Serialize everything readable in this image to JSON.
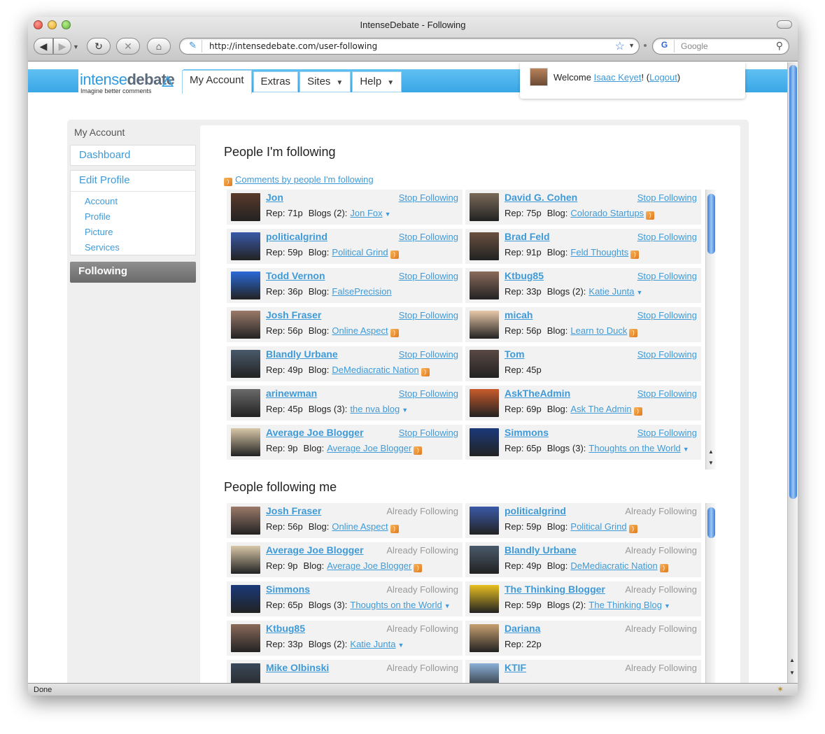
{
  "window": {
    "title": "IntenseDebate - Following"
  },
  "toolbar": {
    "url": "http://intensedebate.com/user-following",
    "search_placeholder": "Google",
    "back_icon": "back-arrow-icon",
    "forward_icon": "forward-arrow-icon",
    "reload_icon": "reload-icon",
    "stop_icon": "stop-icon",
    "home_icon": "home-icon"
  },
  "status": {
    "text": "Done"
  },
  "site": {
    "logo_light": "intense",
    "logo_bold": "debate",
    "tagline": "Imagine better comments",
    "tabs": [
      "My Account",
      "Extras",
      "Sites",
      "Help"
    ],
    "welcome_prefix": "Welcome",
    "user_name": "Isaac Keyet",
    "logout": "Logout"
  },
  "sidebar": {
    "heading": "My Account",
    "dashboard": "Dashboard",
    "edit_profile": "Edit Profile",
    "sub_items": [
      "Account",
      "Profile",
      "Picture",
      "Services"
    ],
    "following": "Following"
  },
  "following": {
    "title": "People I'm following",
    "rss_link": "Comments by people I'm following",
    "action": "Stop Following",
    "items": [
      {
        "name": "Jon",
        "rep": "Rep: 71p",
        "blogs_label": "Blogs (2):",
        "blog": "Jon Fox",
        "kind": "dropdown",
        "avatar": "#5a3a2a"
      },
      {
        "name": "David G. Cohen",
        "rep": "Rep: 75p",
        "blogs_label": "Blog:",
        "blog": "Colorado Startups",
        "kind": "rss",
        "avatar": "#7a6a5a"
      },
      {
        "name": "politicalgrind",
        "rep": "Rep: 59p",
        "blogs_label": "Blog:",
        "blog": "Political Grind",
        "kind": "rss",
        "avatar": "#3a5aa8"
      },
      {
        "name": "Brad Feld",
        "rep": "Rep: 91p",
        "blogs_label": "Blog:",
        "blog": "Feld Thoughts",
        "kind": "rss",
        "avatar": "#6a5040"
      },
      {
        "name": "Todd Vernon",
        "rep": "Rep: 36p",
        "blogs_label": "Blog:",
        "blog": "FalsePrecision",
        "kind": "none",
        "avatar": "#2a6ad8"
      },
      {
        "name": "Ktbug85",
        "rep": "Rep: 33p",
        "blogs_label": "Blogs (2):",
        "blog": "Katie Junta",
        "kind": "dropdown",
        "avatar": "#8a6a5a"
      },
      {
        "name": "Josh Fraser",
        "rep": "Rep: 56p",
        "blogs_label": "Blog:",
        "blog": "Online Aspect",
        "kind": "rss",
        "avatar": "#9a7a6a"
      },
      {
        "name": "micah",
        "rep": "Rep: 56p",
        "blogs_label": "Blog:",
        "blog": "Learn to Duck",
        "kind": "rss",
        "avatar": "#e8c8a8"
      },
      {
        "name": "Blandly Urbane",
        "rep": "Rep: 49p",
        "blogs_label": "Blog:",
        "blog": "DeMediacratic Nation",
        "kind": "rss",
        "avatar": "#4a5a6a"
      },
      {
        "name": "Tom",
        "rep": "Rep: 45p",
        "blogs_label": "",
        "blog": "",
        "kind": "none",
        "avatar": "#5a4a44"
      },
      {
        "name": "arinewman",
        "rep": "Rep: 45p",
        "blogs_label": "Blogs (3):",
        "blog": "the nva blog",
        "kind": "dropdown",
        "avatar": "#6a6a6a"
      },
      {
        "name": "AskTheAdmin",
        "rep": "Rep: 69p",
        "blogs_label": "Blog:",
        "blog": "Ask The Admin",
        "kind": "rss",
        "avatar": "#c85a2a"
      },
      {
        "name": "Average Joe Blogger",
        "rep": "Rep: 9p",
        "blogs_label": "Blog:",
        "blog": "Average Joe Blogger",
        "kind": "rss",
        "avatar": "#d8c8a8"
      },
      {
        "name": "Simmons",
        "rep": "Rep: 65p",
        "blogs_label": "Blogs (3):",
        "blog": "Thoughts on the World",
        "kind": "dropdown",
        "avatar": "#1a3a7a"
      }
    ]
  },
  "followers": {
    "title": "People following me",
    "action": "Already Following",
    "items": [
      {
        "name": "Josh Fraser",
        "rep": "Rep: 56p",
        "blogs_label": "Blog:",
        "blog": "Online Aspect",
        "kind": "rss",
        "avatar": "#9a7a6a"
      },
      {
        "name": "politicalgrind",
        "rep": "Rep: 59p",
        "blogs_label": "Blog:",
        "blog": "Political Grind",
        "kind": "rss",
        "avatar": "#3a5aa8"
      },
      {
        "name": "Average Joe Blogger",
        "rep": "Rep: 9p",
        "blogs_label": "Blog:",
        "blog": "Average Joe Blogger",
        "kind": "rss",
        "avatar": "#d8c8a8"
      },
      {
        "name": "Blandly Urbane",
        "rep": "Rep: 49p",
        "blogs_label": "Blog:",
        "blog": "DeMediacratic Nation",
        "kind": "rss",
        "avatar": "#4a5a6a"
      },
      {
        "name": "Simmons",
        "rep": "Rep: 65p",
        "blogs_label": "Blogs (3):",
        "blog": "Thoughts on the World",
        "kind": "dropdown",
        "avatar": "#1a3a7a"
      },
      {
        "name": "The Thinking Blogger",
        "rep": "Rep: 59p",
        "blogs_label": "Blogs (2):",
        "blog": "The Thinking Blog",
        "kind": "dropdown",
        "avatar": "#e8c020"
      },
      {
        "name": "Ktbug85",
        "rep": "Rep: 33p",
        "blogs_label": "Blogs (2):",
        "blog": "Katie Junta",
        "kind": "dropdown",
        "avatar": "#8a6a5a"
      },
      {
        "name": "Dariana",
        "rep": "Rep: 22p",
        "blogs_label": "",
        "blog": "",
        "kind": "none",
        "avatar": "#c8a070"
      },
      {
        "name": "Mike Olbinski",
        "rep": "",
        "blogs_label": "",
        "blog": "",
        "kind": "none",
        "avatar": "#3a4a5a"
      },
      {
        "name": "KTIF",
        "rep": "",
        "blogs_label": "",
        "blog": "",
        "kind": "none",
        "avatar": "#8ab0d8"
      }
    ]
  }
}
